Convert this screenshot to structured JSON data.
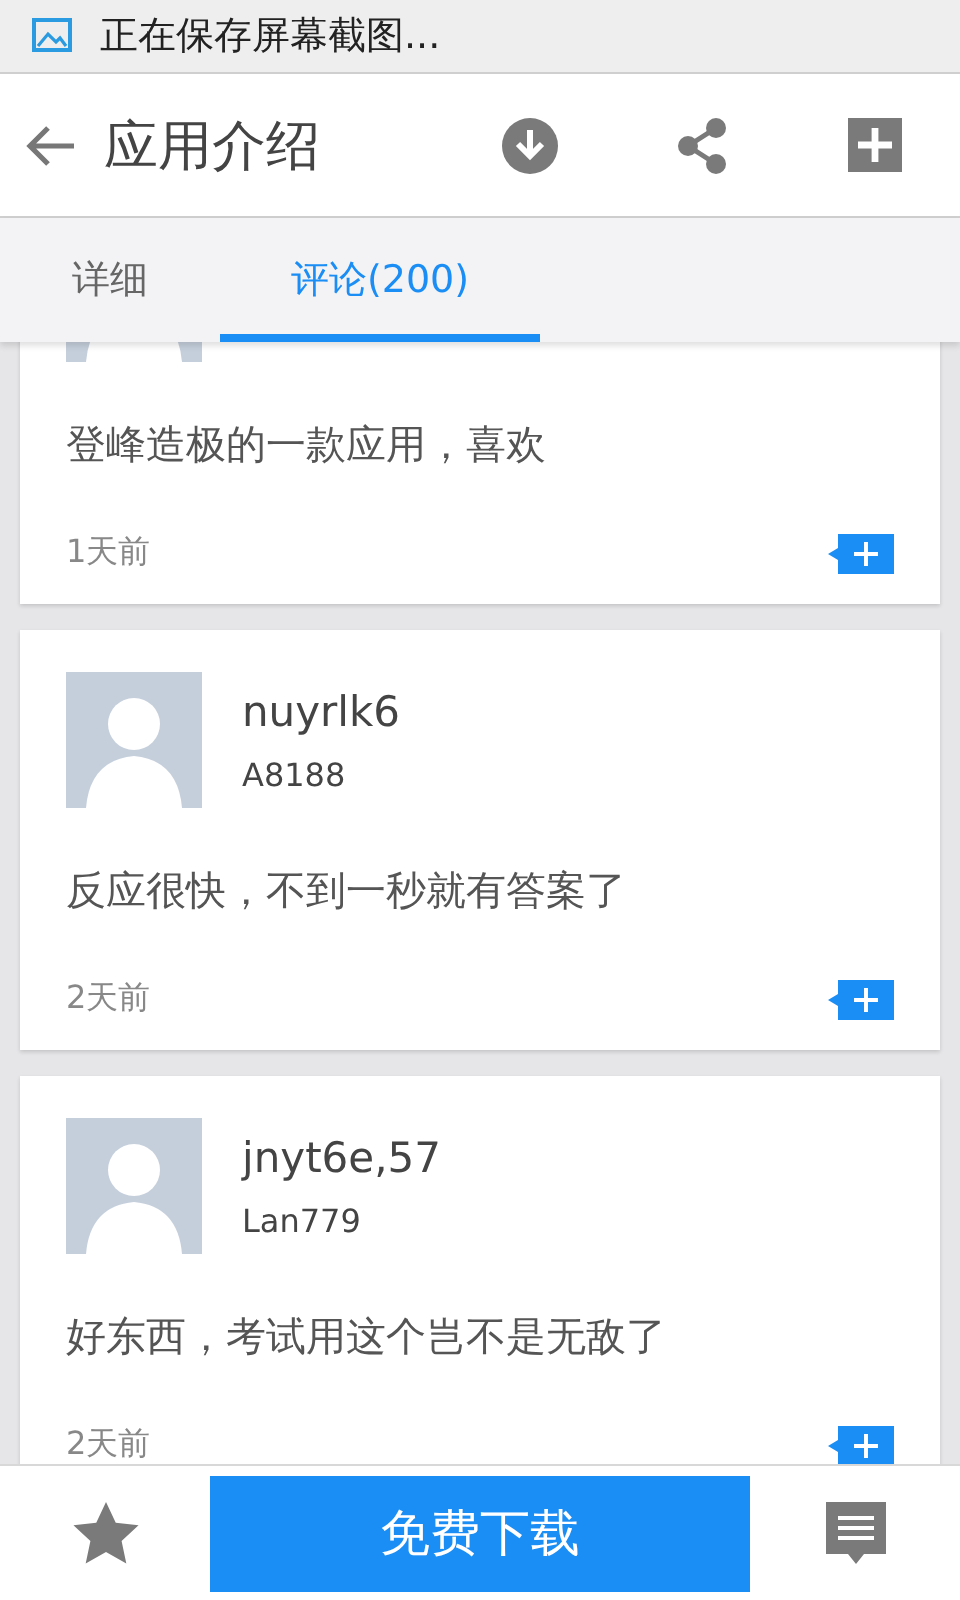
{
  "status_bar": {
    "text": "正在保存屏幕截图..."
  },
  "header": {
    "title": "应用介绍"
  },
  "tabs": [
    {
      "label": "详细",
      "selected": false
    },
    {
      "label": "评论(200)",
      "selected": true
    }
  ],
  "reviews": [
    {
      "text": "登峰造极的一款应用，喜欢",
      "time": "1天前"
    },
    {
      "name": "nuyrlk6",
      "device": "A8188",
      "text": "反应很快，不到一秒就有答案了",
      "time": "2天前"
    },
    {
      "name": "jnyt6e,57",
      "device": "Lan779",
      "text": "好东西，考试用这个岂不是无敌了",
      "time": "2天前"
    }
  ],
  "bottom_bar": {
    "download_label": "免费下载"
  }
}
